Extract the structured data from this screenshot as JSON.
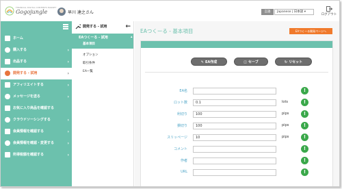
{
  "header": {
    "logo_small": "FINANCIAL DIGITAL CONTENTS MARKET",
    "logo_text": "Gogojungle",
    "username": "早川 達之さん",
    "lang_button": "言語",
    "lang_value": "Japanese | 日本語 ▾",
    "logout_label": "ログアウト"
  },
  "sidebar": {
    "items": [
      {
        "label": "ホーム",
        "arrow": ""
      },
      {
        "label": "購入する",
        "arrow": "›"
      },
      {
        "label": "出品する",
        "arrow": "›"
      },
      {
        "label": "開発する - 試用",
        "arrow": "›"
      },
      {
        "label": "アフィリエイトする",
        "arrow": "›"
      },
      {
        "label": "メッセージを送る",
        "arrow": "›"
      },
      {
        "label": "お気に入り商品を確認する",
        "arrow": ""
      },
      {
        "label": "クラウドソーシングする",
        "arrow": "›"
      },
      {
        "label": "会員情報を確認する",
        "arrow": "›"
      },
      {
        "label": "会員情報を確認・変更する",
        "arrow": "›"
      },
      {
        "label": "所得税額を確認する",
        "arrow": "›"
      }
    ]
  },
  "submenu": {
    "head": "開発する - 試用",
    "back_icon": "arrow-left-icon",
    "group_title": "EAつくーる - 試用",
    "group_caret": "▴",
    "group_item": "基本項目",
    "items": [
      "オプション",
      "取引条件",
      "EA一覧"
    ]
  },
  "main": {
    "page_title": "EAつくーる - 基本項目",
    "help_button": "EAつくーる開発ページへ",
    "toolbar": {
      "create": "EA作成",
      "save": "セーブ",
      "reset": "リセット"
    },
    "fields": [
      {
        "label": "EA名",
        "value": "",
        "unit": ""
      },
      {
        "label": "ロット数",
        "value": "0.1",
        "unit": "lots"
      },
      {
        "label": "利切り",
        "value": "100",
        "unit": "pips"
      },
      {
        "label": "損切り",
        "value": "100",
        "unit": "pips"
      },
      {
        "label": "スリッページ",
        "value": "10",
        "unit": "pips"
      },
      {
        "label": "コメント",
        "value": "",
        "unit": ""
      },
      {
        "label": "作者",
        "value": "",
        "unit": ""
      },
      {
        "label": "URL",
        "value": "",
        "unit": ""
      }
    ],
    "info_glyph": "!"
  },
  "colors": {
    "teal": "#6cc1ad",
    "orange": "#f07a2c",
    "info_green": "#3aa84a",
    "label_blue": "#4aa3c6"
  }
}
